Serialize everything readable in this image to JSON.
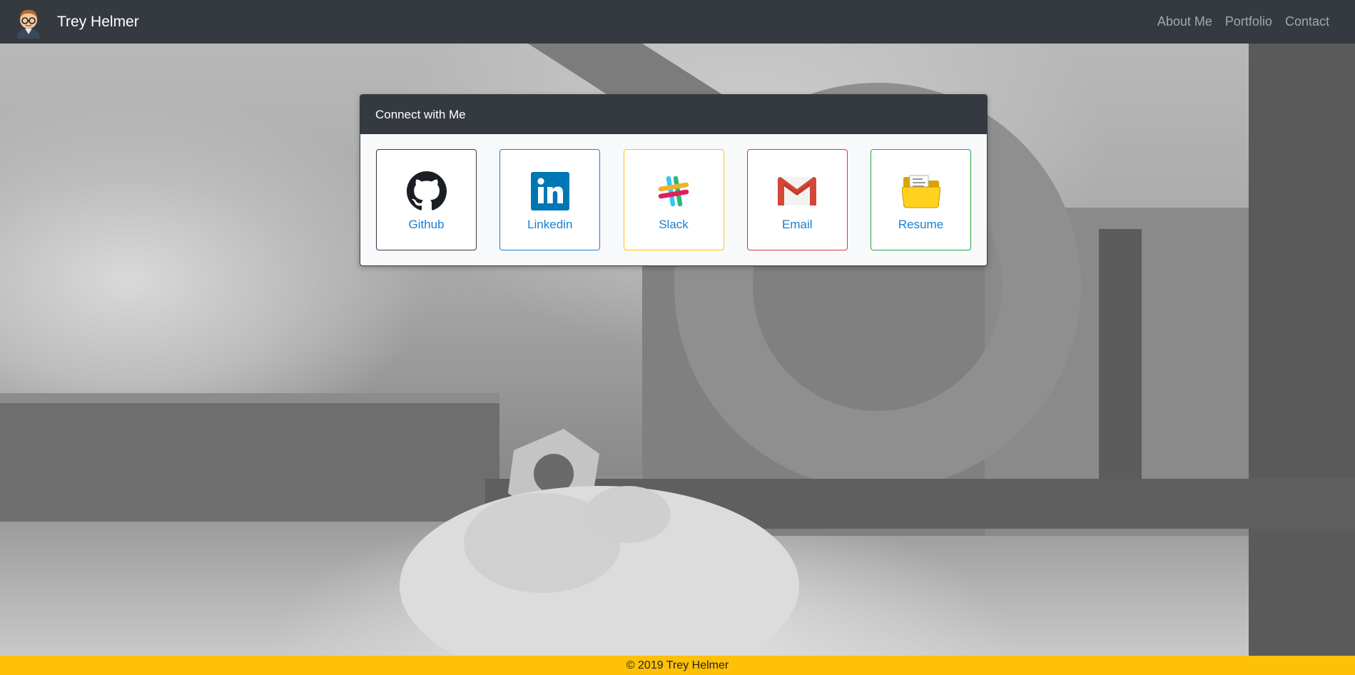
{
  "navbar": {
    "brand_name": "Trey Helmer",
    "avatar_icon": "cartoon-avatar-icon",
    "links": [
      {
        "label": "About Me"
      },
      {
        "label": "Portfolio"
      },
      {
        "label": "Contact"
      }
    ]
  },
  "connect_card": {
    "title": "Connect with Me",
    "tiles": [
      {
        "label": "Github",
        "icon": "github-icon",
        "border_color": "#343a40"
      },
      {
        "label": "Linkedin",
        "icon": "linkedin-icon",
        "border_color": "#1a7fd4"
      },
      {
        "label": "Slack",
        "icon": "slack-icon",
        "border_color": "#ffc107"
      },
      {
        "label": "Email",
        "icon": "gmail-icon",
        "border_color": "#dc3545"
      },
      {
        "label": "Resume",
        "icon": "folder-icon",
        "border_color": "#28a745"
      }
    ]
  },
  "footer": {
    "text": "© 2019 Trey Helmer"
  },
  "colors": {
    "navbar_bg": "#343a40",
    "footer_bg": "#ffc107",
    "link_blue": "#1a7fd4"
  }
}
